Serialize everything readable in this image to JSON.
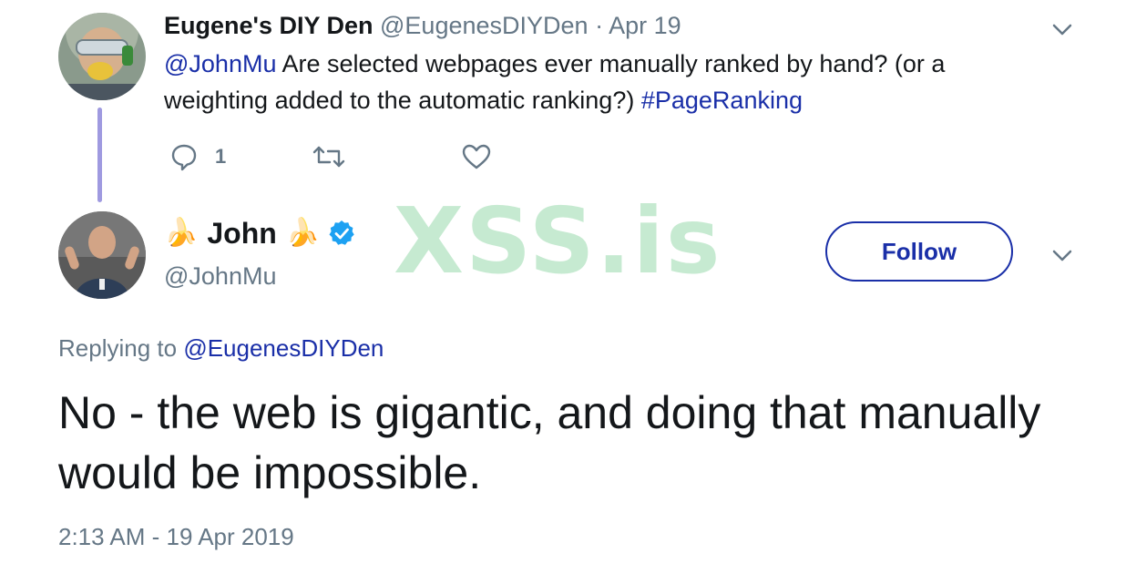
{
  "parent_tweet": {
    "author_name": "Eugene's DIY Den",
    "author_handle": "@EugenesDIYDen",
    "separator": "·",
    "date": "Apr 19",
    "mention": "@JohnMu",
    "text_line1": "Are selected webpages ever manually ranked by hand? (or a",
    "text_line2": "weighting added to the automatic ranking?)",
    "hashtag": "#PageRanking",
    "reply_count": "1",
    "icons": {
      "menu": "chevron-down-icon",
      "reply": "reply-bubble-icon",
      "retweet": "retweet-icon",
      "like": "heart-icon"
    }
  },
  "reply_tweet": {
    "name_emoji_left": "🍌",
    "author_name": "John",
    "name_emoji_right": "🍌",
    "handle": "@JohnMu",
    "follow_label": "Follow",
    "replying_prefix": "Replying to",
    "replying_to": "@EugenesDIYDen",
    "text": "No - the web is gigantic, and doing that manually would be impossible.",
    "timestamp": "2:13 AM - 19 Apr 2019",
    "icons": {
      "verified": "verified-badge-icon",
      "menu": "chevron-down-icon"
    }
  },
  "watermark": "XSS.is",
  "colors": {
    "link": "#1a2fa8",
    "muted": "#657786",
    "thread_line": "#9f9ae0",
    "verified": "#1da1f2",
    "watermark": "#b9e6c6"
  }
}
